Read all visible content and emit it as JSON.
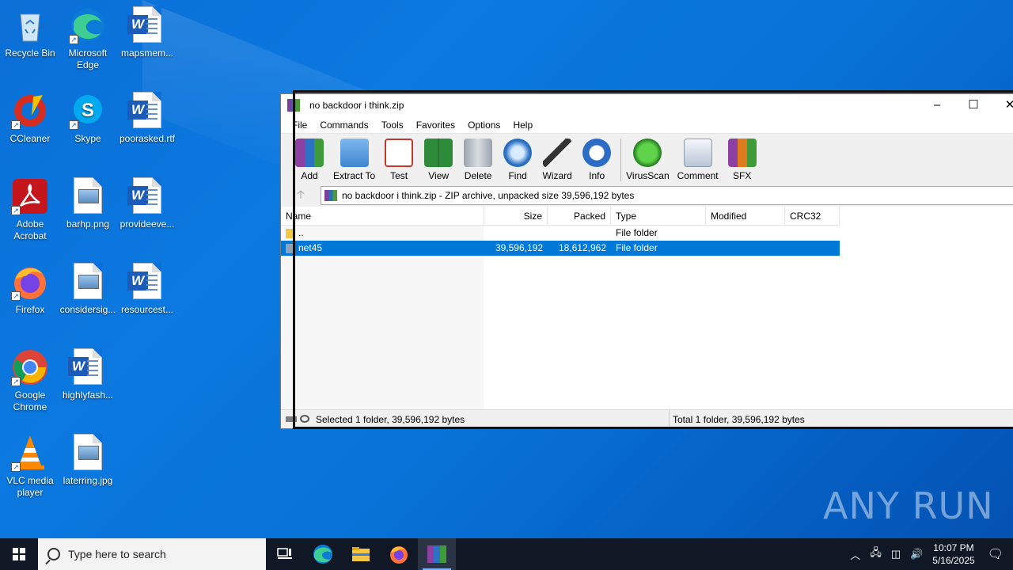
{
  "desktop": {
    "icons": [
      {
        "label": "Recycle Bin"
      },
      {
        "label": "Microsoft Edge"
      },
      {
        "label": "mapsmem..."
      },
      {
        "label": "CCleaner"
      },
      {
        "label": "Skype"
      },
      {
        "label": "poorasked.rtf"
      },
      {
        "label": "Adobe Acrobat"
      },
      {
        "label": "barhp.png"
      },
      {
        "label": "provideeve..."
      },
      {
        "label": "Firefox"
      },
      {
        "label": "considersig..."
      },
      {
        "label": "resourcest..."
      },
      {
        "label": "Google Chrome"
      },
      {
        "label": "highlyfash..."
      },
      {
        "label": "VLC media player"
      },
      {
        "label": "laterring.jpg"
      }
    ]
  },
  "window": {
    "title": "no backdoor i think.zip",
    "menu": [
      "File",
      "Commands",
      "Tools",
      "Favorites",
      "Options",
      "Help"
    ],
    "toolbar": [
      "Add",
      "Extract To",
      "Test",
      "View",
      "Delete",
      "Find",
      "Wizard",
      "Info",
      "VirusScan",
      "Comment",
      "SFX"
    ],
    "address": "no backdoor i think.zip - ZIP archive, unpacked size 39,596,192 bytes",
    "columns": [
      "Name",
      "Size",
      "Packed",
      "Type",
      "Modified",
      "CRC32"
    ],
    "rows": [
      {
        "name": "..",
        "size": "",
        "packed": "",
        "type": "File folder",
        "modified": "",
        "crc": ""
      },
      {
        "name": "net45",
        "size": "39,596,192",
        "packed": "18,612,962",
        "type": "File folder",
        "modified": "",
        "crc": ""
      }
    ],
    "status_left": "Selected 1 folder, 39,596,192 bytes",
    "status_right": "Total 1 folder, 39,596,192 bytes"
  },
  "taskbar": {
    "search_placeholder": "Type here to search",
    "time": "10:07 PM",
    "date": "5/16/2025"
  },
  "watermark": "ANY RUN",
  "colors": {
    "selection": "#0078d7",
    "taskbar": "#101826"
  }
}
